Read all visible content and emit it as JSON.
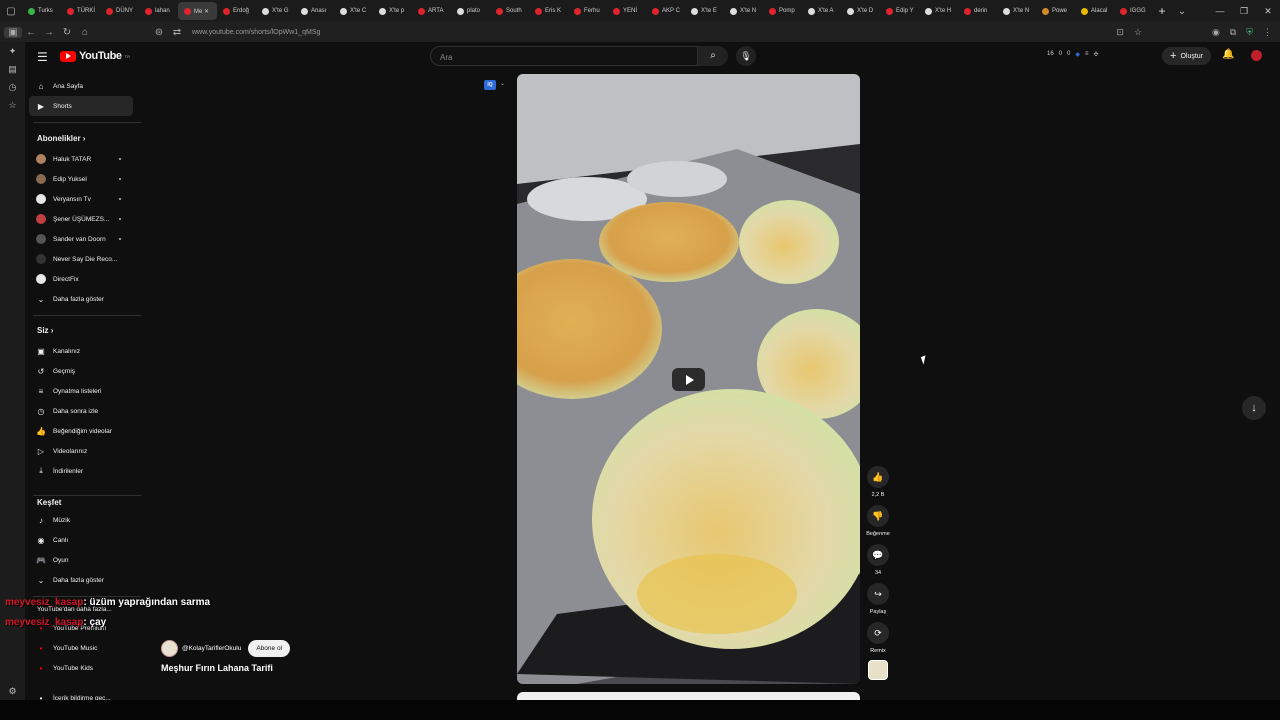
{
  "browser": {
    "tabs": [
      {
        "label": "Turks",
        "color": "#39b54a"
      },
      {
        "label": "TÜRKİ",
        "color": "#e0242b"
      },
      {
        "label": "DÜNY",
        "color": "#e0242b"
      },
      {
        "label": "lahan",
        "color": "#e0242b"
      },
      {
        "label": "Me ✕",
        "color": "#e0242b",
        "active": true
      },
      {
        "label": "Erdoğ",
        "color": "#e0242b"
      },
      {
        "label": "X'te G",
        "color": "#dddddd"
      },
      {
        "label": "Anası",
        "color": "#dddddd"
      },
      {
        "label": "X'te C",
        "color": "#dddddd"
      },
      {
        "label": "X'te p",
        "color": "#dddddd"
      },
      {
        "label": "ARTA",
        "color": "#e0242b"
      },
      {
        "label": "plato",
        "color": "#dddddd"
      },
      {
        "label": "South",
        "color": "#e0242b"
      },
      {
        "label": "Eris K",
        "color": "#e0242b"
      },
      {
        "label": "Ferhu",
        "color": "#e0242b"
      },
      {
        "label": "YENİ",
        "color": "#e0242b"
      },
      {
        "label": "AKP C",
        "color": "#e0242b"
      },
      {
        "label": "X'te E",
        "color": "#dddddd"
      },
      {
        "label": "X'te N",
        "color": "#dddddd"
      },
      {
        "label": "Pomp",
        "color": "#e0242b"
      },
      {
        "label": "X'te A",
        "color": "#dddddd"
      },
      {
        "label": "X'te D",
        "color": "#dddddd"
      },
      {
        "label": "Edip Y",
        "color": "#e0242b"
      },
      {
        "label": "X'te H",
        "color": "#dddddd"
      },
      {
        "label": "derin",
        "color": "#e0242b"
      },
      {
        "label": "X'te N",
        "color": "#dddddd"
      },
      {
        "label": "Powe",
        "color": "#d08a28"
      },
      {
        "label": "Alacal",
        "color": "#e6b800"
      },
      {
        "label": "IGGG",
        "color": "#e0242b"
      }
    ],
    "new_tab": "+",
    "url": "www.youtube.com/shorts/lOpWw1_qMSg"
  },
  "header": {
    "logo_text": "YouTube",
    "logo_region": "TR",
    "search_placeholder": "Ara",
    "counters": [
      "16",
      "0",
      "0"
    ],
    "create_label": "Oluştur"
  },
  "sidebar": {
    "main": [
      {
        "label": "Ana Sayfa",
        "icon": "home-icon"
      },
      {
        "label": "Shorts",
        "icon": "shorts-icon",
        "active": true
      }
    ],
    "subscriptions_title": "Abonelikler",
    "subscriptions": [
      {
        "label": "Haluk TATAR",
        "color": "#b08060"
      },
      {
        "label": "Edip Yuksel",
        "color": "#8a6a50"
      },
      {
        "label": "Veryansın Tv",
        "color": "#e8e8e8"
      },
      {
        "label": "Şener ÜŞÜMEZS...",
        "color": "#c04040"
      },
      {
        "label": "Sander van Doorn",
        "color": "#555555"
      },
      {
        "label": "Never Say Die Reco...",
        "color": "#333333"
      },
      {
        "label": "DirectFix",
        "color": "#e8e8e8"
      }
    ],
    "show_more": "Daha fazla göster",
    "you_title": "Siz",
    "you": [
      {
        "label": "Kanalınız",
        "icon": "channel-icon"
      },
      {
        "label": "Geçmiş",
        "icon": "history-icon"
      },
      {
        "label": "Oynatma listeleri",
        "icon": "playlist-icon"
      },
      {
        "label": "Daha sonra izle",
        "icon": "clock-icon"
      },
      {
        "label": "Beğendiğim videolar",
        "icon": "thumbs-up-icon"
      },
      {
        "label": "Videolarınız",
        "icon": "video-icon"
      },
      {
        "label": "İndirilenler",
        "icon": "download-icon"
      }
    ],
    "explore_title": "Keşfet",
    "explore": [
      {
        "label": "Müzik",
        "icon": "music-icon"
      },
      {
        "label": "Canlı",
        "icon": "live-icon"
      },
      {
        "label": "Oyun",
        "icon": "gaming-icon"
      },
      {
        "label": "Daha fazla göster",
        "icon": "chevron-down-icon"
      }
    ],
    "more_title": "YouTube'dan daha fazla...",
    "more": [
      {
        "label": "YouTube Premium"
      },
      {
        "label": "YouTube Music"
      },
      {
        "label": "YouTube Kids"
      }
    ],
    "cut_off_item": "İçerik bildirme geç..."
  },
  "chat": [
    {
      "user": "meyvesiz_kasap",
      "message": ": üzüm yaprağından sarma"
    },
    {
      "user": "meyvesiz_kasap",
      "message": ": çay"
    }
  ],
  "video": {
    "channel": "@KolayTariflerOkulu",
    "subscribe": "Abone ol",
    "title": "Meşhur Fırın Lahana Tarifi"
  },
  "actions": {
    "like_count": "2,2 B",
    "dislike_label": "Beğenme",
    "comment_count": "34",
    "share_label": "Paylaş",
    "remix_label": "Remix"
  },
  "colors": {
    "background": "#0f0f0f",
    "accent": "#ff0000",
    "chat_user": "#d4142a"
  }
}
